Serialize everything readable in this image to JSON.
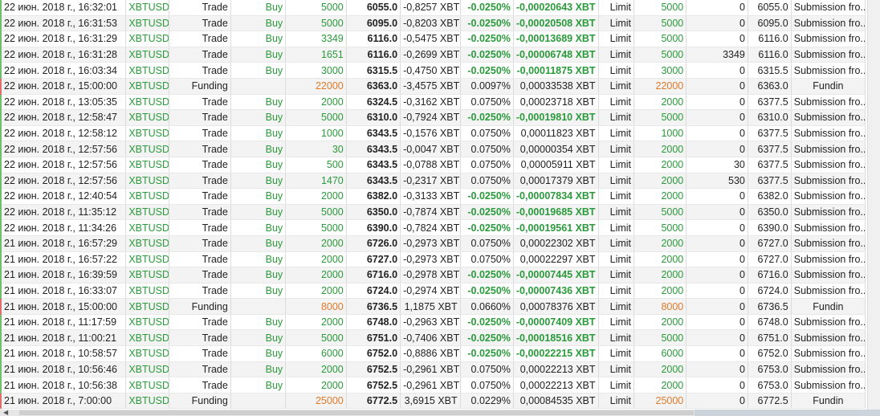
{
  "rows": [
    [
      "22 июн. 2018 г., 16:32:01",
      "XBTUSD",
      "Trade",
      "Buy",
      "5000",
      "6055.0",
      "-0,8257 XBT",
      "-0.0250%",
      "-0,00020643 XBT",
      "Limit",
      "5000",
      "0",
      "6055.0",
      "Submission fro.."
    ],
    [
      "22 июн. 2018 г., 16:31:53",
      "XBTUSD",
      "Trade",
      "Buy",
      "5000",
      "6095.0",
      "-0,8203 XBT",
      "-0.0250%",
      "-0,00020508 XBT",
      "Limit",
      "5000",
      "0",
      "6095.0",
      "Submission fro.."
    ],
    [
      "22 июн. 2018 г., 16:31:29",
      "XBTUSD",
      "Trade",
      "Buy",
      "3349",
      "6116.0",
      "-0,5475 XBT",
      "-0.0250%",
      "-0,00013689 XBT",
      "Limit",
      "5000",
      "0",
      "6116.0",
      "Submission fro.."
    ],
    [
      "22 июн. 2018 г., 16:31:28",
      "XBTUSD",
      "Trade",
      "Buy",
      "1651",
      "6116.0",
      "-0,2699 XBT",
      "-0.0250%",
      "-0,00006748 XBT",
      "Limit",
      "5000",
      "3349",
      "6116.0",
      "Submission fro.."
    ],
    [
      "22 июн. 2018 г., 16:03:34",
      "XBTUSD",
      "Trade",
      "Buy",
      "3000",
      "6315.5",
      "-0,4750 XBT",
      "-0.0250%",
      "-0,00011875 XBT",
      "Limit",
      "3000",
      "0",
      "6315.5",
      "Submission fro.."
    ],
    [
      "22 июн. 2018 г., 15:00:00",
      "XBTUSD",
      "Funding",
      "",
      "22000",
      "6363.0",
      "-3,4575 XBT",
      "0.0097%",
      "0,00033538 XBT",
      "Limit",
      "22000",
      "0",
      "6363.0",
      "Fundin"
    ],
    [
      "22 июн. 2018 г., 13:05:35",
      "XBTUSD",
      "Trade",
      "Buy",
      "2000",
      "6324.5",
      "-0,3162 XBT",
      "0.0750%",
      "0,00023718 XBT",
      "Limit",
      "2000",
      "0",
      "6377.5",
      "Submission fro.."
    ],
    [
      "22 июн. 2018 г., 12:58:47",
      "XBTUSD",
      "Trade",
      "Buy",
      "5000",
      "6310.0",
      "-0,7924 XBT",
      "-0.0250%",
      "-0,00019810 XBT",
      "Limit",
      "5000",
      "0",
      "6310.0",
      "Submission fro.."
    ],
    [
      "22 июн. 2018 г., 12:58:12",
      "XBTUSD",
      "Trade",
      "Buy",
      "1000",
      "6343.5",
      "-0,1576 XBT",
      "0.0750%",
      "0,00011823 XBT",
      "Limit",
      "1000",
      "0",
      "6377.5",
      "Submission fro.."
    ],
    [
      "22 июн. 2018 г., 12:57:56",
      "XBTUSD",
      "Trade",
      "Buy",
      "30",
      "6343.5",
      "-0,0047 XBT",
      "0.0750%",
      "0,00000354 XBT",
      "Limit",
      "2000",
      "0",
      "6377.5",
      "Submission fro.."
    ],
    [
      "22 июн. 2018 г., 12:57:56",
      "XBTUSD",
      "Trade",
      "Buy",
      "500",
      "6343.5",
      "-0,0788 XBT",
      "0.0750%",
      "0,00005911 XBT",
      "Limit",
      "2000",
      "30",
      "6377.5",
      "Submission fro.."
    ],
    [
      "22 июн. 2018 г., 12:57:56",
      "XBTUSD",
      "Trade",
      "Buy",
      "1470",
      "6343.5",
      "-0,2317 XBT",
      "0.0750%",
      "0,00017379 XBT",
      "Limit",
      "2000",
      "530",
      "6377.5",
      "Submission fro.."
    ],
    [
      "22 июн. 2018 г., 12:40:54",
      "XBTUSD",
      "Trade",
      "Buy",
      "2000",
      "6382.0",
      "-0,3133 XBT",
      "-0.0250%",
      "-0,00007834 XBT",
      "Limit",
      "2000",
      "0",
      "6382.0",
      "Submission fro.."
    ],
    [
      "22 июн. 2018 г., 11:35:12",
      "XBTUSD",
      "Trade",
      "Buy",
      "5000",
      "6350.0",
      "-0,7874 XBT",
      "-0.0250%",
      "-0,00019685 XBT",
      "Limit",
      "5000",
      "0",
      "6350.0",
      "Submission fro.."
    ],
    [
      "22 июн. 2018 г., 11:34:26",
      "XBTUSD",
      "Trade",
      "Buy",
      "5000",
      "6390.0",
      "-0,7824 XBT",
      "-0.0250%",
      "-0,00019561 XBT",
      "Limit",
      "5000",
      "0",
      "6390.0",
      "Submission fro.."
    ],
    [
      "21 июн. 2018 г., 16:57:29",
      "XBTUSD",
      "Trade",
      "Buy",
      "2000",
      "6726.0",
      "-0,2973 XBT",
      "0.0750%",
      "0,00022302 XBT",
      "Limit",
      "2000",
      "0",
      "6727.0",
      "Submission fro.."
    ],
    [
      "21 июн. 2018 г., 16:57:22",
      "XBTUSD",
      "Trade",
      "Buy",
      "2000",
      "6727.0",
      "-0,2973 XBT",
      "0.0750%",
      "0,00022297 XBT",
      "Limit",
      "2000",
      "0",
      "6727.0",
      "Submission fro.."
    ],
    [
      "21 июн. 2018 г., 16:39:59",
      "XBTUSD",
      "Trade",
      "Buy",
      "2000",
      "6716.0",
      "-0,2978 XBT",
      "-0.0250%",
      "-0,00007445 XBT",
      "Limit",
      "2000",
      "0",
      "6716.0",
      "Submission fro.."
    ],
    [
      "21 июн. 2018 г., 16:33:07",
      "XBTUSD",
      "Trade",
      "Buy",
      "2000",
      "6724.0",
      "-0,2974 XBT",
      "-0.0250%",
      "-0,00007436 XBT",
      "Limit",
      "2000",
      "0",
      "6724.0",
      "Submission fro.."
    ],
    [
      "21 июн. 2018 г., 15:00:00",
      "XBTUSD",
      "Funding",
      "",
      "8000",
      "6736.5",
      "1,1875 XBT",
      "0.0660%",
      "0,00078376 XBT",
      "Limit",
      "8000",
      "0",
      "6736.5",
      "Fundin"
    ],
    [
      "21 июн. 2018 г., 11:17:59",
      "XBTUSD",
      "Trade",
      "Buy",
      "2000",
      "6748.0",
      "-0,2963 XBT",
      "-0.0250%",
      "-0,00007409 XBT",
      "Limit",
      "2000",
      "0",
      "6748.0",
      "Submission fro.."
    ],
    [
      "21 июн. 2018 г., 11:00:21",
      "XBTUSD",
      "Trade",
      "Buy",
      "5000",
      "6751.0",
      "-0,7406 XBT",
      "-0.0250%",
      "-0,00018516 XBT",
      "Limit",
      "5000",
      "0",
      "6751.0",
      "Submission fro.."
    ],
    [
      "21 июн. 2018 г., 10:58:57",
      "XBTUSD",
      "Trade",
      "Buy",
      "6000",
      "6752.0",
      "-0,8886 XBT",
      "-0.0250%",
      "-0,00022215 XBT",
      "Limit",
      "6000",
      "0",
      "6752.0",
      "Submission fro.."
    ],
    [
      "21 июн. 2018 г., 10:56:46",
      "XBTUSD",
      "Trade",
      "Buy",
      "2000",
      "6752.5",
      "-0,2961 XBT",
      "0.0750%",
      "0,00022213 XBT",
      "Limit",
      "2000",
      "0",
      "6753.0",
      "Submission fro.."
    ],
    [
      "21 июн. 2018 г., 10:56:38",
      "XBTUSD",
      "Trade",
      "Buy",
      "2000",
      "6752.5",
      "-0,2961 XBT",
      "0.0750%",
      "0,00022213 XBT",
      "Limit",
      "2000",
      "0",
      "6753.0",
      "Submission fro.."
    ],
    [
      "21 июн. 2018 г., 7:00:00",
      "XBTUSD",
      "Funding",
      "",
      "25000",
      "6772.5",
      "3,6915 XBT",
      "0.0229%",
      "0,00084535 XBT",
      "Limit",
      "25000",
      "0",
      "6772.5",
      "Fundin"
    ]
  ],
  "colors": {
    "green": "#2a9a3a",
    "orange": "#e07a2a",
    "red_marker": "#e07070"
  }
}
